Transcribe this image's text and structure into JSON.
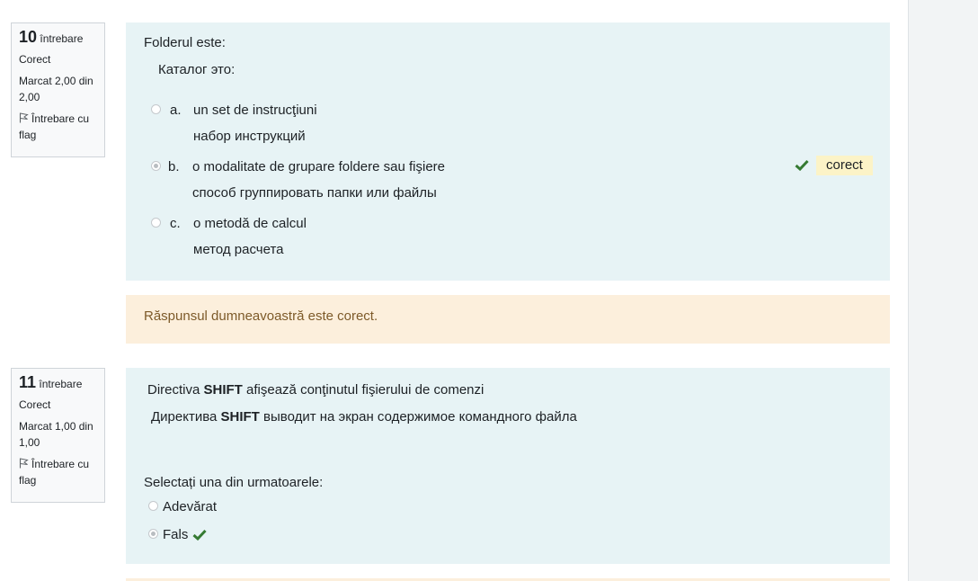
{
  "questions": [
    {
      "number": "10",
      "number_suffix": "întrebare",
      "state": "Corect",
      "grade": "Marcat 2,00 din 2,00",
      "flag_label": "Întrebare cu flag",
      "text_ro": "Folderul este:",
      "text_ru": "Каталог это:",
      "options": [
        {
          "letter": "a.",
          "ro": "un set de instrucţiuni",
          "ru": "набор инструкций",
          "selected": false
        },
        {
          "letter": "b.",
          "ro": "o modalitate de grupare foldere sau fişiere",
          "ru": "способ группировать папки или файлы",
          "selected": true
        },
        {
          "letter": "c.",
          "ro": "o metodă de calcul",
          "ru": "метод расчета",
          "selected": false
        }
      ],
      "correct_badge": "corect",
      "feedback": "Răspunsul dumneavoastră este corect."
    },
    {
      "number": "11",
      "number_suffix": "întrebare",
      "state": "Corect",
      "grade": "Marcat 1,00 din 1,00",
      "flag_label": "Întrebare cu flag",
      "text_ro_before": "Directiva ",
      "text_ro_bold": "SHIFT",
      "text_ro_after": " afişează conţinutul fişierului de comenzi",
      "text_ru_before": "Директива ",
      "text_ru_bold": "SHIFT",
      "text_ru_after": " выводит на экран содержимое командного файла",
      "prompt": "Selectați una din urmatoarele:",
      "options": [
        {
          "label": "Adevărat",
          "selected": false
        },
        {
          "label": "Fals",
          "selected": true
        }
      ]
    }
  ],
  "colors": {
    "formulation_bg": "#e7f3f5",
    "feedback_bg": "#fcefdc",
    "feedback_text": "#7d5a29",
    "correct_green": "#357a32",
    "badge_bg": "#fcf3c7"
  },
  "icons": {
    "flag": "flag-icon",
    "correct": "check-icon"
  }
}
